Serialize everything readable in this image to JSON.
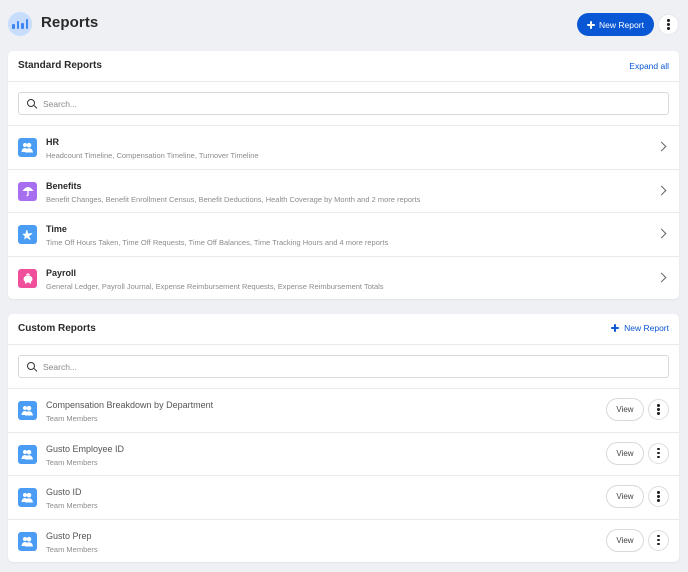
{
  "header": {
    "title": "Reports",
    "logo_icon": "bar-chart-icon",
    "new_report_label": "New Report",
    "more_icon": "kebab-icon"
  },
  "colors": {
    "primary": "#0a57d6",
    "hr": "#4a9cf5",
    "benefits": "#a86ef0",
    "time": "#4a9cf5",
    "payroll": "#ef4f9b"
  },
  "standard": {
    "title": "Standard Reports",
    "expand_label": "Expand all",
    "search_placeholder": "Search...",
    "items": [
      {
        "title": "HR",
        "subtitle": "Headcount Timeline, Compensation Timeline, Turnover Timeline",
        "icon": "people-icon"
      },
      {
        "title": "Benefits",
        "subtitle": "Benefit Changes, Benefit Enrollment Census, Benefit Deductions, Health Coverage by Month and 2 more reports",
        "icon": "umbrella-icon"
      },
      {
        "title": "Time",
        "subtitle": "Time Off Hours Taken, Time Off Requests, Time Off Balances, Time Tracking Hours and 4 more reports",
        "icon": "airplane-icon"
      },
      {
        "title": "Payroll",
        "subtitle": "General Ledger, Payroll Journal, Expense Reimbursement Requests, Expense Reimbursement Totals",
        "icon": "piggy-bank-icon"
      }
    ]
  },
  "custom": {
    "title": "Custom Reports",
    "new_report_label": "New Report",
    "search_placeholder": "Search...",
    "view_label": "View",
    "items": [
      {
        "title": "Compensation Breakdown by Department",
        "subtitle": "Team Members",
        "icon": "people-icon"
      },
      {
        "title": "Gusto Employee ID",
        "subtitle": "Team Members",
        "icon": "people-icon"
      },
      {
        "title": "Gusto ID",
        "subtitle": "Team Members",
        "icon": "people-icon"
      },
      {
        "title": "Gusto Prep",
        "subtitle": "Team Members",
        "icon": "people-icon"
      }
    ]
  }
}
